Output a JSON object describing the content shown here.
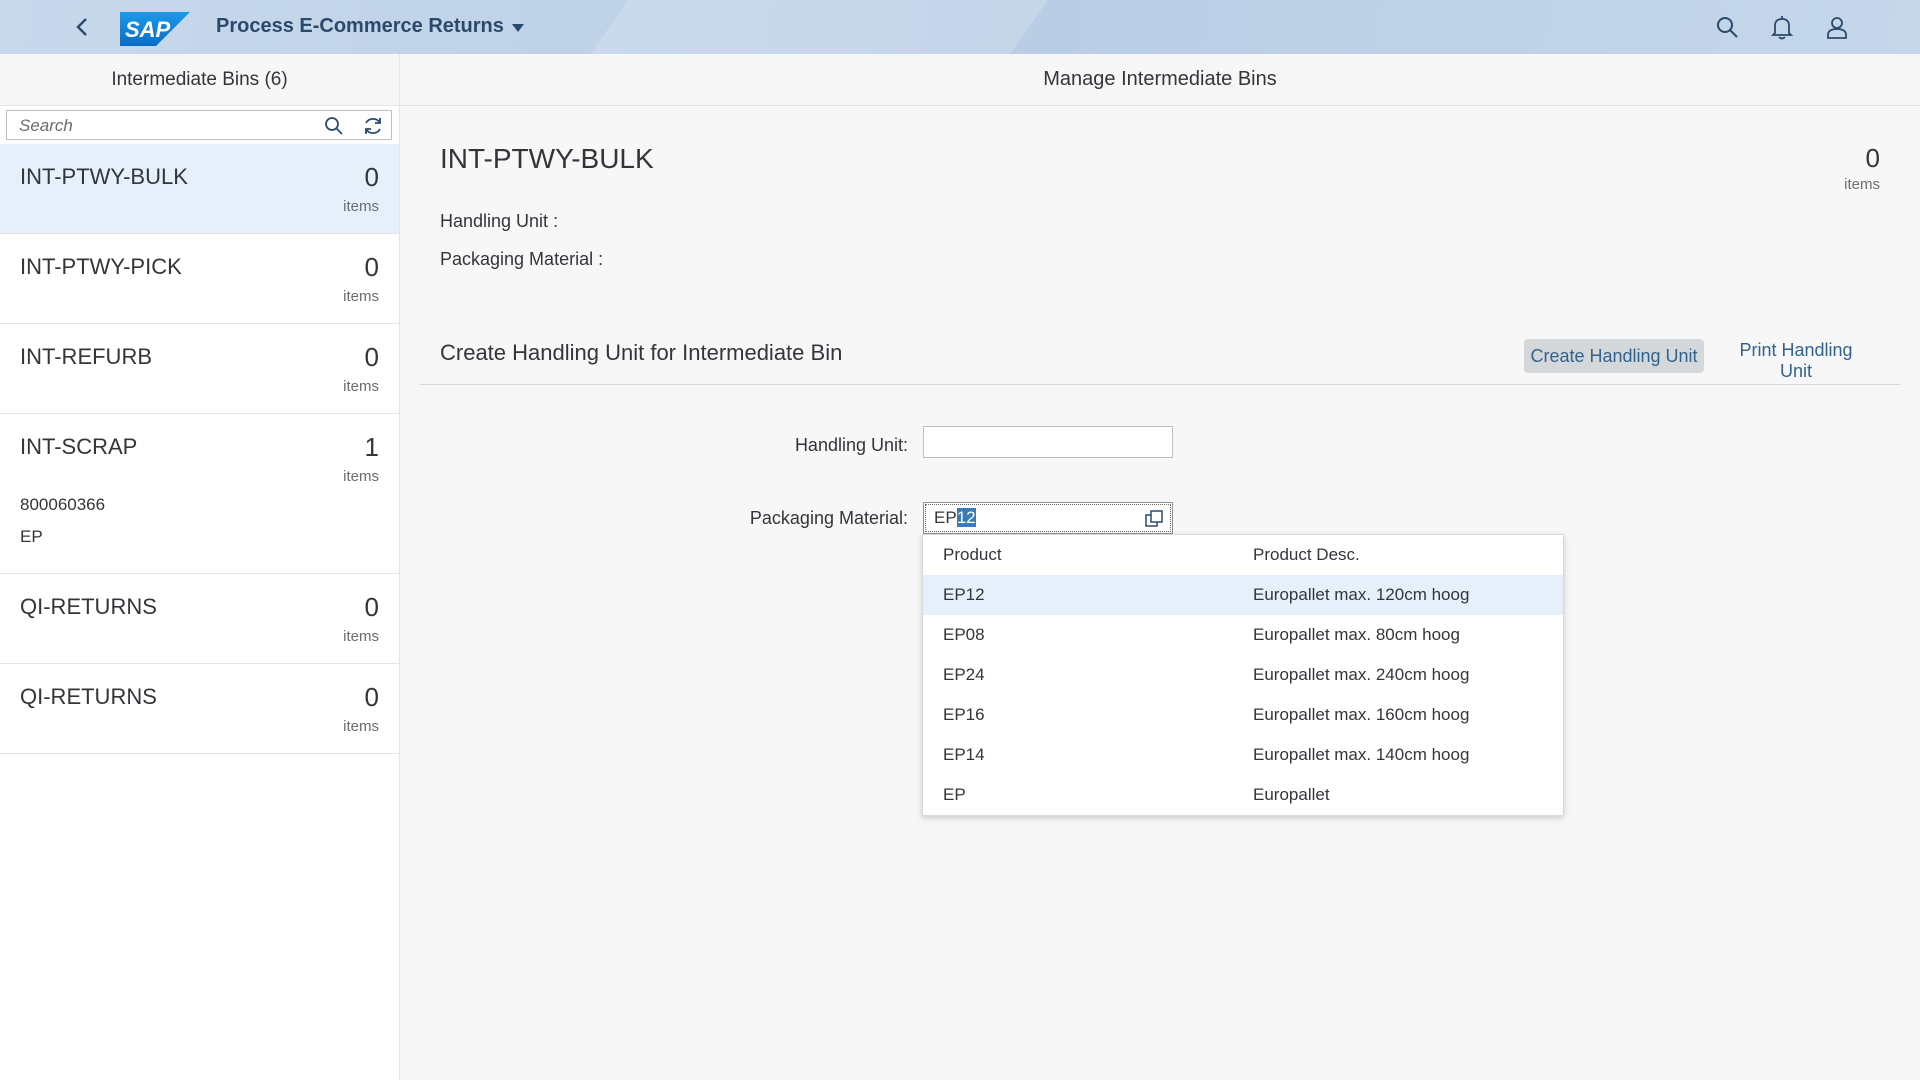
{
  "shell": {
    "app_title": "Process E-Commerce Returns",
    "logo_text": "SAP",
    "icons": [
      "back-icon",
      "search-icon",
      "bell-icon",
      "user-icon"
    ],
    "colors": {
      "header_bg": "#bfd2e8",
      "logo_blue": "#0a7cd1",
      "title": "#2b4a6b"
    }
  },
  "master": {
    "title": "Intermediate Bins (6)",
    "search_placeholder": "Search",
    "items": [
      {
        "name": "INT-PTWY-BULK",
        "count": "0",
        "unit": "items",
        "attrs": []
      },
      {
        "name": "INT-PTWY-PICK",
        "count": "0",
        "unit": "items",
        "attrs": []
      },
      {
        "name": "INT-REFURB",
        "count": "0",
        "unit": "items",
        "attrs": []
      },
      {
        "name": "INT-SCRAP",
        "count": "1",
        "unit": "items",
        "attrs": [
          "800060366",
          "EP"
        ]
      },
      {
        "name": "QI-RETURNS",
        "count": "0",
        "unit": "items",
        "attrs": []
      },
      {
        "name": "QI-RETURNS",
        "count": "0",
        "unit": "items",
        "attrs": []
      }
    ]
  },
  "detail": {
    "header": "Manage Intermediate Bins",
    "object_title": "INT-PTWY-BULK",
    "object_count": "0",
    "object_unit": "items",
    "attr_handling_unit": "Handling Unit :",
    "attr_packaging_material": "Packaging Material :",
    "section_title": "Create Handling Unit for Intermediate Bin",
    "create_button": "Create Handling Unit",
    "print_button": "Print Handling Unit",
    "form": {
      "hu_label": "Handling Unit:",
      "hu_value": "",
      "pm_label": "Packaging Material:",
      "pm_typed": "EP",
      "pm_selected": "12"
    }
  },
  "suggestions": {
    "col_product": "Product",
    "col_desc": "Product Desc.",
    "rows": [
      {
        "product": "EP12",
        "desc": "Europallet max. 120cm hoog"
      },
      {
        "product": "EP08",
        "desc": "Europallet max. 80cm hoog"
      },
      {
        "product": "EP24",
        "desc": "Europallet max. 240cm hoog"
      },
      {
        "product": "EP16",
        "desc": "Europallet max. 160cm hoog"
      },
      {
        "product": "EP14",
        "desc": "Europallet max. 140cm hoog"
      },
      {
        "product": "EP",
        "desc": "Europallet"
      }
    ]
  }
}
